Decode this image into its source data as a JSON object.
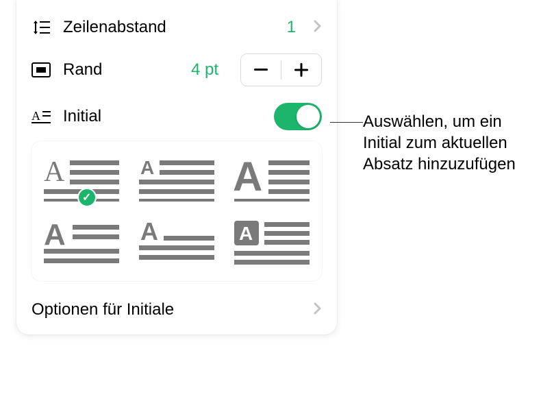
{
  "spacing": {
    "label": "Zeilenabstand",
    "value": "1"
  },
  "border": {
    "label": "Rand",
    "value": "4 pt"
  },
  "initial": {
    "label": "Initial"
  },
  "options": {
    "label": "Optionen für Initiale"
  },
  "callout": {
    "text": "Auswählen, um ein Initial zum aktuellen Absatz hinzuzufügen"
  },
  "styles": [
    {
      "name": "dropcap-style-1",
      "selected": true
    },
    {
      "name": "dropcap-style-2",
      "selected": false
    },
    {
      "name": "dropcap-style-3",
      "selected": false
    },
    {
      "name": "dropcap-style-4",
      "selected": false
    },
    {
      "name": "dropcap-style-5",
      "selected": false
    },
    {
      "name": "dropcap-style-6",
      "selected": false
    }
  ]
}
